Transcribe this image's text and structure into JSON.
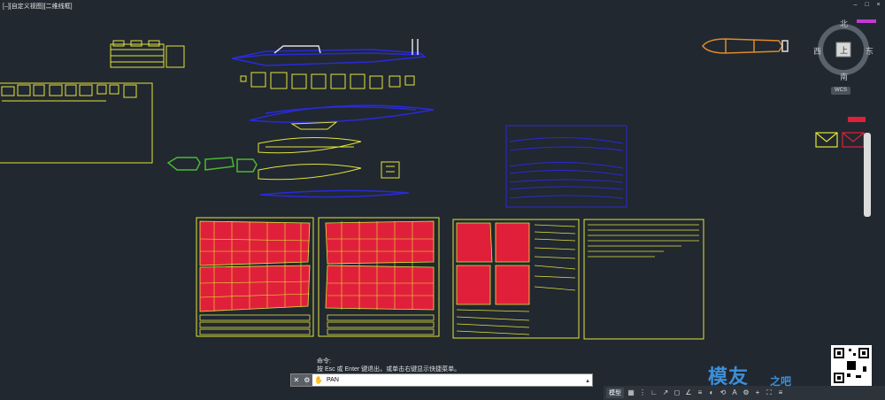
{
  "viewport": {
    "label": "[–][自定义视图][二维线框]"
  },
  "window_controls": {
    "minimize": "–",
    "restore": "□",
    "close": "×"
  },
  "viewcube": {
    "north": "北",
    "south": "南",
    "east": "东",
    "west": "西",
    "top": "上",
    "wcs": "WCS"
  },
  "command": {
    "history_label": "命令:",
    "history_line": "按 Esc 或 Enter 键退出，或单击右键显示快捷菜单。",
    "input_value": "PAN",
    "close_glyph": "✕",
    "options_glyph": "⚙",
    "pan_icon": "hand-pan-icon",
    "caret_glyph": "▴"
  },
  "statusbar": {
    "model_tab": "模型",
    "icons": [
      "grid-icon",
      "snap-icon",
      "ortho-icon",
      "polar-icon",
      "osnap-icon",
      "otrack-icon",
      "lineweight-icon",
      "transparency-icon",
      "selection-cycle-icon",
      "annotation-icon",
      "workspace-icon",
      "settings-icon",
      "fullscreen-icon",
      "menu-icon"
    ]
  },
  "watermark": {
    "text": "模友",
    "sub": "之吧"
  },
  "colors": {
    "background": "#212830",
    "yellow": "#e4e43a",
    "red": "#e0203a",
    "blue": "#2a2ad8",
    "green": "#4ab832",
    "orange": "#e08a2a",
    "magenta": "#c23ad0"
  }
}
